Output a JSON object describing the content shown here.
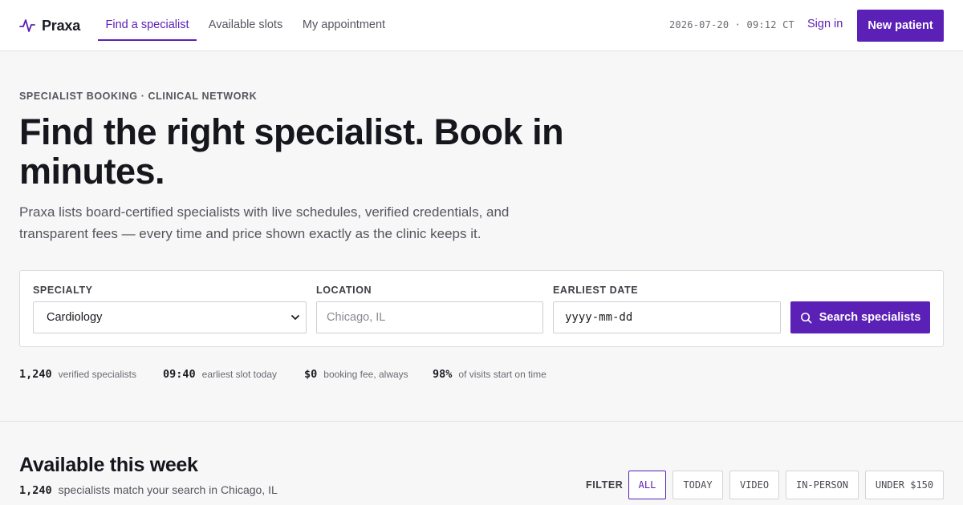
{
  "brand": {
    "name": "Praxa"
  },
  "nav": {
    "tabs": [
      {
        "label": "Find a specialist",
        "active": true
      },
      {
        "label": "Available slots",
        "active": false
      },
      {
        "label": "My appointment",
        "active": false
      }
    ]
  },
  "header": {
    "clock": "2026-07-20 · 09:12 CT",
    "sign_in": "Sign in",
    "new_patient": "New patient"
  },
  "hero": {
    "eyebrow": "SPECIALIST BOOKING · CLINICAL NETWORK",
    "title": "Find the right specialist. Book in minutes.",
    "lede": "Praxa lists board-certified specialists with live schedules, verified credentials, and transparent fees — every time and price shown exactly as the clinic keeps it."
  },
  "search": {
    "specialty_label": "SPECIALTY",
    "specialty_value": "Cardiology",
    "location_label": "LOCATION",
    "location_placeholder": "Chicago, IL",
    "date_label": "EARLIEST DATE",
    "date_placeholder": "yyyy-mm-dd",
    "button_label": "Search specialists"
  },
  "stats": [
    {
      "value": "1,240",
      "label": "verified specialists"
    },
    {
      "value": "09:40",
      "label": "earliest slot today"
    },
    {
      "value": "$0",
      "label": "booking fee, always"
    },
    {
      "value": "98%",
      "label": "of visits start on time"
    }
  ],
  "section": {
    "title": "Available this week",
    "match_count": "1,240",
    "match_text": "specialists match your search in Chicago, IL",
    "filter_label": "FILTER",
    "filters": [
      {
        "label": "ALL",
        "active": true
      },
      {
        "label": "TODAY",
        "active": false
      },
      {
        "label": "VIDEO",
        "active": false
      },
      {
        "label": "IN-PERSON",
        "active": false
      },
      {
        "label": "UNDER $150",
        "active": false
      }
    ]
  },
  "colors": {
    "accent": "#5b21b6",
    "background": "#f7f7f7",
    "surface": "#ffffff"
  },
  "icons": [
    "pulse-logo-icon",
    "chevron-down-icon",
    "search-icon"
  ]
}
